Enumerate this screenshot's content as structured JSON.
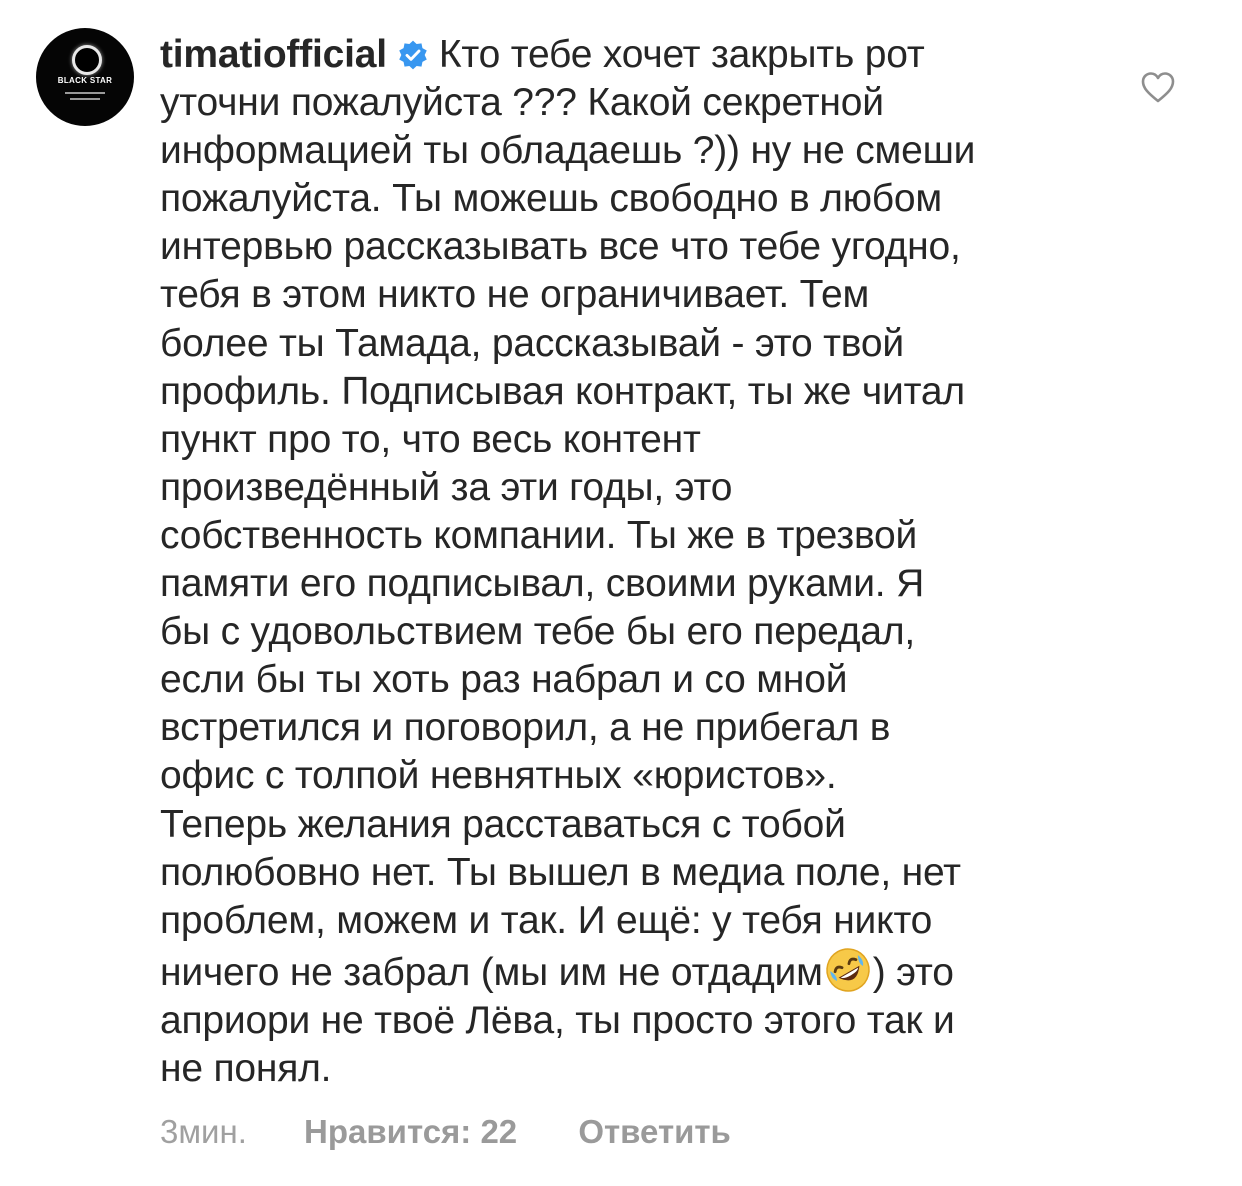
{
  "comment": {
    "username": "timatiofficial",
    "avatar_label": "BLACK STAR",
    "lines": [
      "Кто тебе хочет закрыть рот",
      "уточни пожалуйста ??? Какой секретной",
      "информацией ты обладаешь ?)) ну не смеши",
      "пожалуйста. Ты можешь свободно в любом",
      "интервью рассказывать все что тебе угодно,",
      "тебя в этом никто не ограничивает. Тем",
      "более ты Тамада, рассказывай - это твой",
      "профиль. Подписывая контракт, ты же читал",
      "пункт про то, что весь контент",
      "произведённый за эти годы, это",
      "собственность компании. Ты же в трезвой",
      "памяти его подписывал, своими руками. Я",
      "бы с удовольствием тебе бы его передал,",
      "если бы ты хоть раз набрал и со мной",
      "встретился и поговорил, а не прибегал в",
      "офис с толпой невнятных «юристов».",
      "Теперь желания расставаться с тобой",
      "полюбовно нет. Ты вышел в медиа поле, нет",
      "проблем, можем и так. И ещё: у тебя никто"
    ],
    "line_emoji_before": "ничего не забрал (мы им не отдадим",
    "line_emoji_after": ") это",
    "lines_end": [
      "априори не твоё Лёва, ты просто этого так и",
      "не понял."
    ],
    "emoji_name": "rolling-on-floor-laughing-emoji"
  },
  "footer": {
    "time": "3мин.",
    "likes": "Нравится: 22",
    "reply": "Ответить"
  },
  "icons": {
    "verified": "verified-badge-icon",
    "like": "heart-icon"
  },
  "colors": {
    "text": "#262626",
    "meta": "#a0a0a0",
    "verified": "#3897f0"
  }
}
